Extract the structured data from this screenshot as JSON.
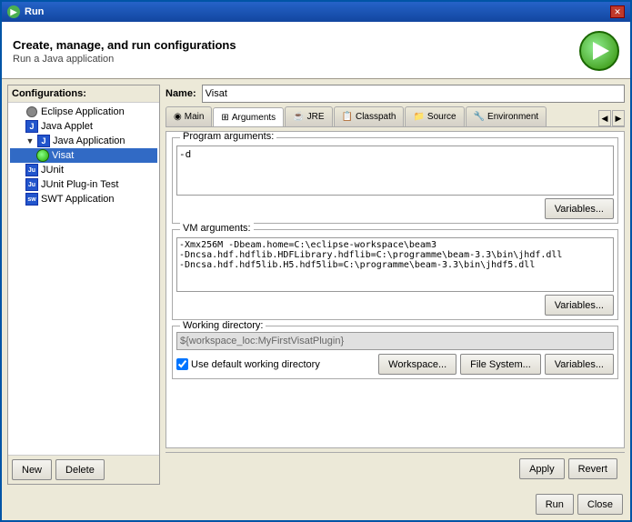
{
  "window": {
    "title": "Run",
    "icon": "run-icon"
  },
  "header": {
    "title": "Create, manage, and run configurations",
    "subtitle": "Run a Java application"
  },
  "left_panel": {
    "label": "Configurations:",
    "items": [
      {
        "id": "eclipse-app",
        "label": "Eclipse Application",
        "indent": 1,
        "type": "circle-gray"
      },
      {
        "id": "java-applet",
        "label": "Java Applet",
        "indent": 1,
        "type": "j-blue",
        "check": true
      },
      {
        "id": "java-app",
        "label": "Java Application",
        "indent": 1,
        "type": "j-blue",
        "expanded": true,
        "check": true
      },
      {
        "id": "visat",
        "label": "Visat",
        "indent": 2,
        "type": "run-small",
        "selected": true
      },
      {
        "id": "junit",
        "label": "JUnit",
        "indent": 1,
        "type": "j-blue",
        "letter": "Ju"
      },
      {
        "id": "junit-plugin",
        "label": "JUnit Plug-in Test",
        "indent": 1,
        "type": "j-blue",
        "letter": "Ju"
      },
      {
        "id": "swt-app",
        "label": "SWT Application",
        "indent": 1,
        "type": "j-blue",
        "letter": "sw"
      }
    ],
    "new_button": "New",
    "delete_button": "Delete"
  },
  "main": {
    "name_label": "Name:",
    "name_value": "Visat",
    "tabs": [
      {
        "id": "main",
        "label": "Main",
        "icon": "◉"
      },
      {
        "id": "arguments",
        "label": "Arguments",
        "icon": "⊞",
        "active": true
      },
      {
        "id": "jre",
        "label": "JRE",
        "icon": "☕"
      },
      {
        "id": "classpath",
        "label": "Classpath",
        "icon": "📋"
      },
      {
        "id": "source",
        "label": "Source",
        "icon": "📁"
      },
      {
        "id": "environment",
        "label": "Environment",
        "icon": "🔧"
      }
    ],
    "program_args": {
      "label": "Program arguments:",
      "value": "-d",
      "variables_btn": "Variables..."
    },
    "vm_args": {
      "label": "VM arguments:",
      "value": "-Xmx256M -Dbeam.home=C:\\eclipse-workspace\\beam3\n-Dncsa.hdf.hdflib.HDFLibrary.hdflib=C:\\programme\\beam-3.3\\bin\\jhdf.dll\n-Dncsa.hdf.hdf5lib.H5.hdf5lib=C:\\programme\\beam-3.3\\bin\\jhdf5.dll",
      "variables_btn": "Variables..."
    },
    "working_dir": {
      "label": "Working directory:",
      "value": "${workspace_loc:MyFirstVisatPlugin}",
      "placeholder": "${workspace_loc:MyFirstVisatPlugin}",
      "checkbox_label": "Use default working directory",
      "checked": true,
      "workspace_btn": "Workspace...",
      "filesystem_btn": "File System...",
      "variables_btn": "Variables..."
    }
  },
  "footer": {
    "apply_btn": "Apply",
    "revert_btn": "Revert",
    "run_btn": "Run",
    "close_btn": "Close"
  }
}
